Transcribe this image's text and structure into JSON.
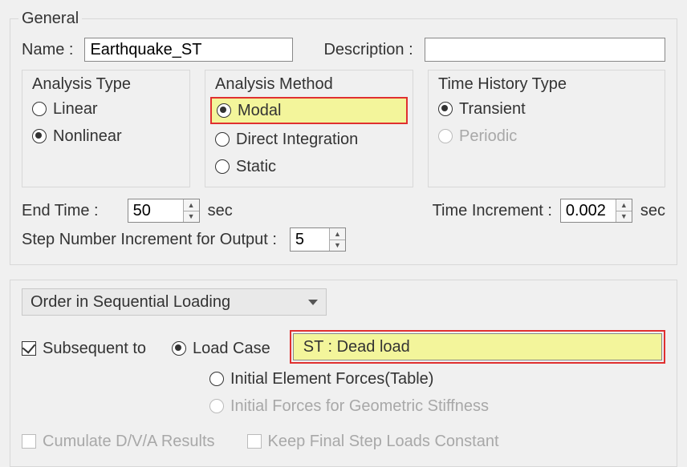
{
  "general": {
    "legend": "General",
    "name_label": "Name :",
    "name_value": "Earthquake_ST",
    "description_label": "Description :",
    "description_value": "",
    "analysis_type": {
      "legend": "Analysis Type",
      "linear": "Linear",
      "nonlinear": "Nonlinear",
      "selected": "nonlinear"
    },
    "analysis_method": {
      "legend": "Analysis Method",
      "modal": "Modal",
      "direct_integration": "Direct Integration",
      "static": "Static",
      "selected": "modal"
    },
    "time_history_type": {
      "legend": "Time History Type",
      "transient": "Transient",
      "periodic": "Periodic",
      "selected": "transient"
    },
    "end_time_label": "End Time :",
    "end_time_value": "50",
    "end_time_unit": "sec",
    "time_increment_label": "Time Increment :",
    "time_increment_value": "0.002",
    "time_increment_unit": "sec",
    "step_number_label": "Step Number Increment for Output :",
    "step_number_value": "5"
  },
  "loading": {
    "order_label": "Order in Sequential Loading",
    "subsequent_to_label": "Subsequent to",
    "subsequent_to_checked": true,
    "selection_type": "load_case",
    "load_case_label": "Load Case",
    "load_case_value": "ST : Dead load",
    "initial_forces_table_label": "Initial Element Forces(Table)",
    "initial_forces_geom_label": "Initial Forces for Geometric Stiffness",
    "cumulate_label": "Cumulate D/V/A Results",
    "cumulate_checked": false,
    "keep_final_label": "Keep Final Step Loads Constant",
    "keep_final_checked": false
  }
}
